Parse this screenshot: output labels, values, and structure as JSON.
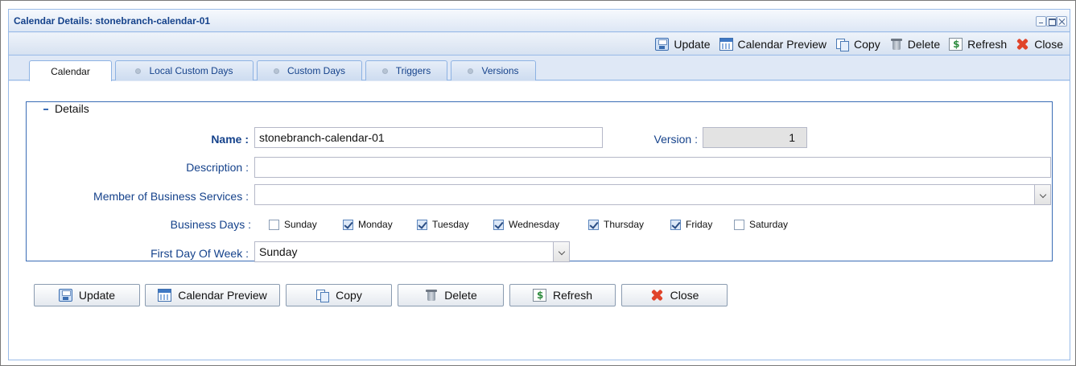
{
  "window": {
    "title": "Calendar Details: stonebranch-calendar-01"
  },
  "toolbar": {
    "update": "Update",
    "calendar_preview": "Calendar Preview",
    "copy": "Copy",
    "delete": "Delete",
    "refresh": "Refresh",
    "close": "Close"
  },
  "tabs": [
    {
      "label": "Calendar",
      "active": true
    },
    {
      "label": "Local Custom Days",
      "active": false
    },
    {
      "label": "Custom Days",
      "active": false
    },
    {
      "label": "Triggers",
      "active": false
    },
    {
      "label": "Versions",
      "active": false
    }
  ],
  "details": {
    "legend": "Details",
    "name_label": "Name :",
    "name_value": "stonebranch-calendar-01",
    "version_label": "Version :",
    "version_value": "1",
    "description_label": "Description :",
    "description_value": "",
    "member_label": "Member of Business Services :",
    "member_value": "",
    "business_days_label": "Business Days :",
    "business_days": [
      {
        "label": "Sunday",
        "checked": false
      },
      {
        "label": "Monday",
        "checked": true
      },
      {
        "label": "Tuesday",
        "checked": true
      },
      {
        "label": "Wednesday",
        "checked": true
      },
      {
        "label": "Thursday",
        "checked": true
      },
      {
        "label": "Friday",
        "checked": true
      },
      {
        "label": "Saturday",
        "checked": false
      }
    ],
    "first_day_label": "First Day Of Week :",
    "first_day_value": "Sunday"
  },
  "buttons": {
    "update": "Update",
    "calendar_preview": "Calendar Preview",
    "copy": "Copy",
    "delete": "Delete",
    "refresh": "Refresh",
    "close": "Close"
  },
  "colors": {
    "accent": "#15428b",
    "border": "#99bbe8",
    "fieldset_border": "#3a6cb5"
  }
}
